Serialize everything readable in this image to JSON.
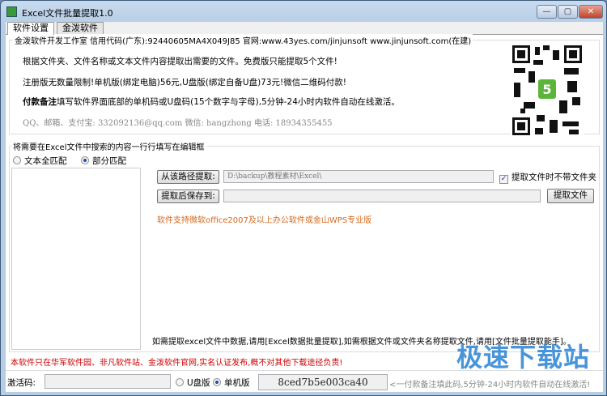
{
  "window": {
    "title": "Excel文件批量提取1.0",
    "controls": [
      "—",
      "▢",
      "✕"
    ]
  },
  "tabs": [
    {
      "label": "软件设置"
    },
    {
      "label": "金泼软件"
    }
  ],
  "info": {
    "legend": "金泼软件开发工作室 信用代码(广东):92440605MA4X049J85 官网:www.43yes.com/jinjunsoft  www.jinjunsoft.com(在建)",
    "line1": "根据文件夹、文件名称或文本文件内容提取出需要的文件。免费版只能提取5个文件!",
    "line2": "注册版无数量限制!单机版(绑定电脑)56元,U盘版(绑定自备U盘)73元!微信二维码付款!",
    "line3_bold": "付款备注",
    "line3": "填写软件界面底部的单机码或U盘码(15个数字与字母),5分钟-24小时内软件自动在线激活。",
    "contact": "QQ、邮箱、支付宝: 332092136@qq.com   微信: hangzhong   电话: 18934355455"
  },
  "search": {
    "legend": "将需要在Excel文件中搜索的内容一行行填写在编辑框",
    "match_full": "文本全匹配",
    "match_partial": "部分匹配",
    "selected": "部分匹配",
    "source_button": "从该路径提取:",
    "source_path": "D:\\backup\\教程素材\\Excel\\",
    "no_folder_label": "提取文件时不带文件夹",
    "no_folder_checked": true,
    "save_button": "提取后保存到:",
    "save_path": "",
    "extract_button": "提取文件",
    "support_note": "软件支持微软office2007及以上办公软件或金山WPS专业版",
    "hint": "如需提取excel文件中数据,请用[Excel数据批量提取],如需根据文件或文件夹名称提取文件,请用[文件批量提取能手]。"
  },
  "notice": "本软件只在华军软件园、非凡软件站、金泼软件官网,实名认证发布,概不对其他下载途径负责!",
  "activation": {
    "label": "激活码:",
    "value": "",
    "usb_label": "U盘版",
    "pc_label": "单机版",
    "selected": "单机版",
    "machine_code": "8ced7b5e003ca40",
    "hint": "<一付款备注填此码,5分钟-24小时内软件自动在线激活!"
  },
  "watermark": "极速下载站",
  "colors": {
    "orange": "#d2691e",
    "red": "#cc0000",
    "watermark": "#2882d2"
  }
}
